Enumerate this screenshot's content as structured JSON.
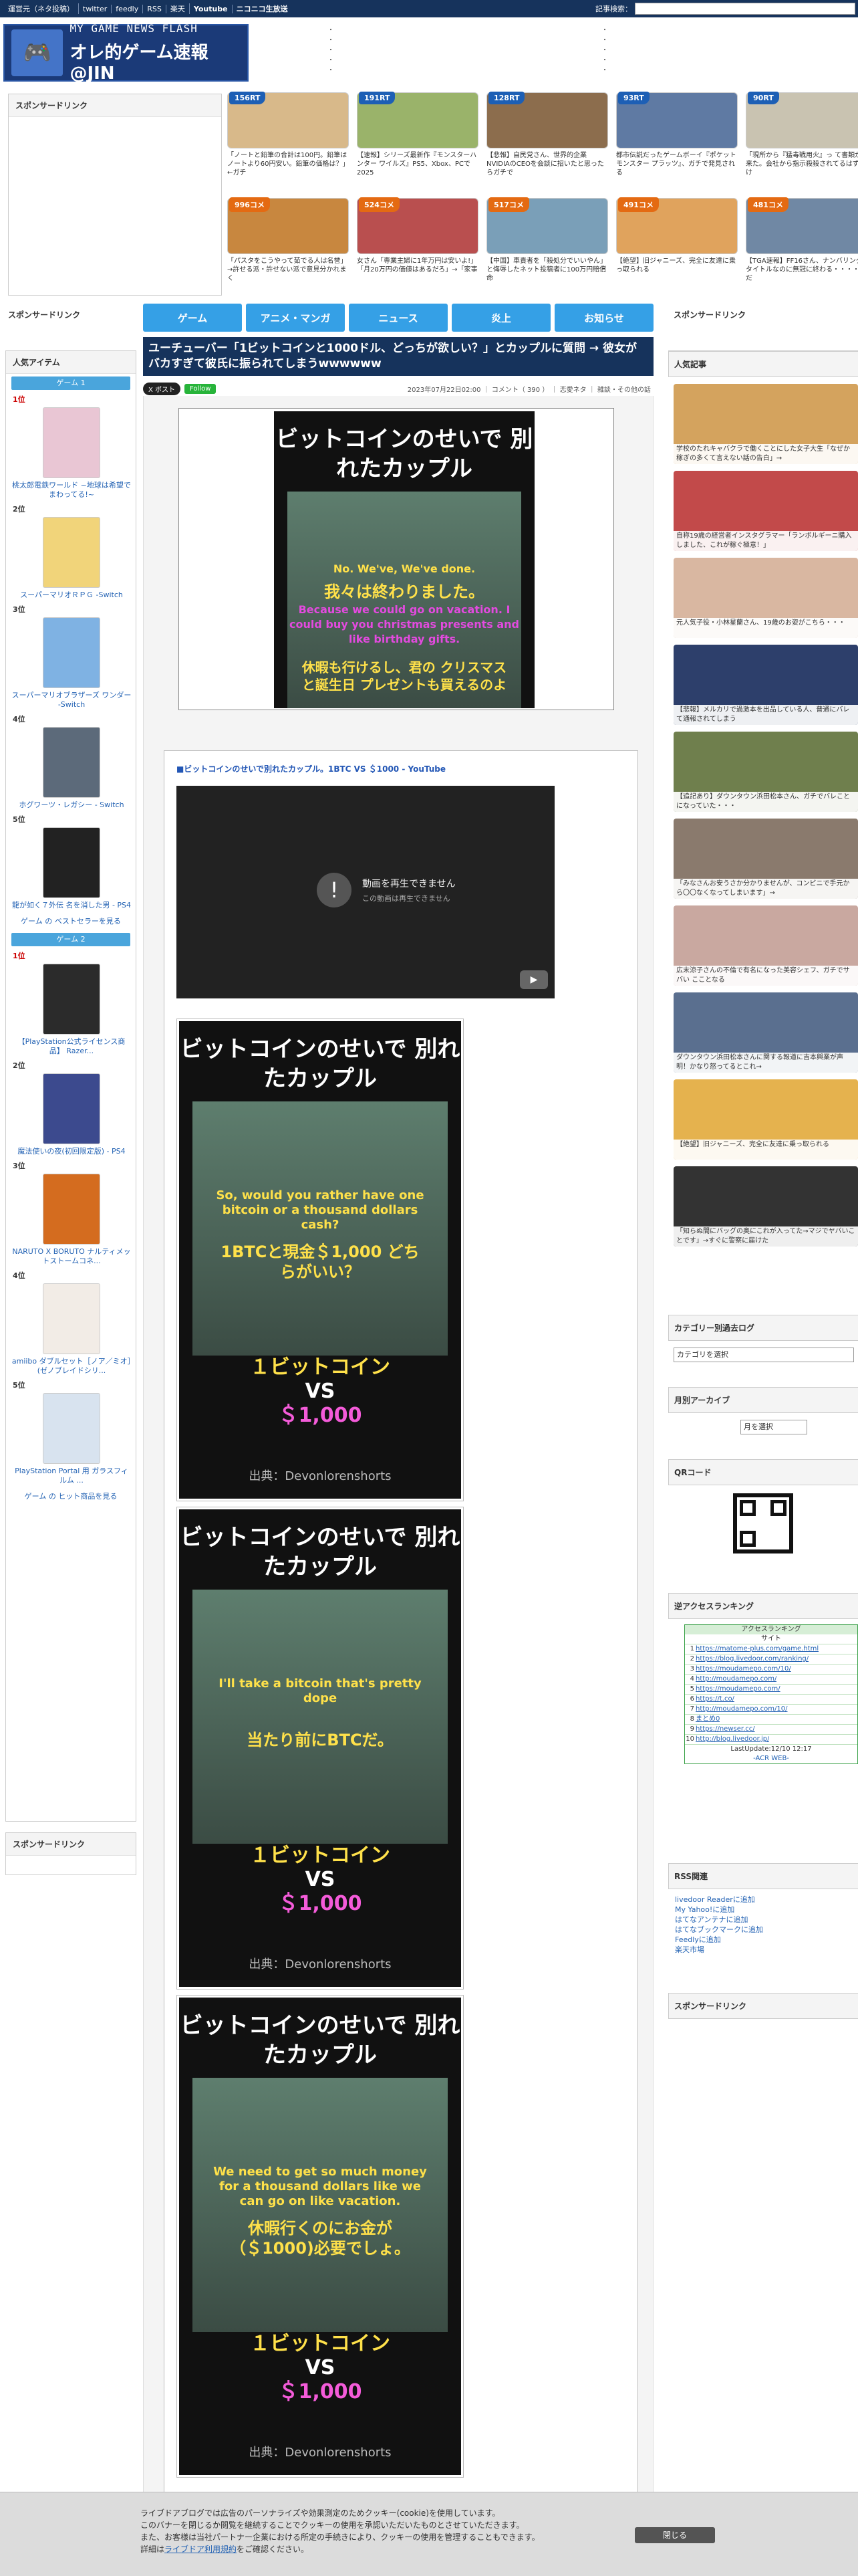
{
  "topbar": {
    "links": [
      "運営元（ネタ投稿）",
      "twitter",
      "feedly",
      "RSS",
      "楽天",
      "Youtube",
      "ニコニコ生放送"
    ],
    "search_label": "記事検索："
  },
  "site": {
    "logo_line1": "MY GAME NEWS FLASH",
    "logo_line2": "オレ的ゲーム速報@JIN"
  },
  "header_sponsor_title": "スポンサードリンク",
  "thumbs": [
    {
      "count": "156RT",
      "caption": "「ノートと鉛筆の合計は100円。鉛筆はノートより60円安い。鉛筆の価格は？」←ガチ"
    },
    {
      "count": "191RT",
      "caption": "【速報】シリーズ最新作『モンスターハンター ワイルズ』PS5、Xbox、PCで2025"
    },
    {
      "count": "128RT",
      "caption": "【悲報】自民党さん、世界的企業NVIDIAのCEOを会談に招いたと思ったらガチで"
    },
    {
      "count": "93RT",
      "caption": "都市伝説だったゲームボーイ『ポケットモンスター プラッツ』、ガチで発見される"
    },
    {
      "count": "90RT",
      "caption": "「現所から『猛毒戦用火』っ て書類が来た。会社から指示殺殺されてるはずだけ"
    },
    {
      "count": "996コメ",
      "caption": "「パスタをこうやって茹でる人は名誉」→許せる派・許せない派で意見分かれまく"
    },
    {
      "count": "524コメ",
      "caption": "女さん「専業主婦に1年万円は安いよ!」「月20万円の価値はあるだろ」→「家事"
    },
    {
      "count": "517コメ",
      "caption": "【中国】車責者を「殺処分でいいやん」と侮辱したネット投稿者に100万円賠償命"
    },
    {
      "count": "491コメ",
      "caption": "【絶望】旧ジャニーズ、完全に友達に乗っ取られる"
    },
    {
      "count": "481コメ",
      "caption": "【TGA速報】FF16さん、ナンバリングタイトルなのに無冠に終わる・・・・まだ"
    }
  ],
  "nav": [
    "ゲーム",
    "アニメ・マンガ",
    "ニュース",
    "炎上",
    "お知らせ"
  ],
  "left": {
    "sponsor_title": "スポンサードリンク",
    "items_title": "人気アイテム",
    "tab1": "ゲーム 1",
    "tab2": "ゲーム 2",
    "ranks1": [
      {
        "rank": "1位",
        "name": "桃太郎電鉄ワールド ~地球は希望でまわってる!~"
      },
      {
        "rank": "2位",
        "name": "スーパーマリオＲＰＧ -Switch"
      },
      {
        "rank": "3位",
        "name": "スーパーマリオブラザーズ ワンダー -Switch"
      },
      {
        "rank": "4位",
        "name": "ホグワーツ・レガシー - Switch"
      },
      {
        "rank": "5位",
        "name": "龍が如く７外伝 名を消した男 - PS4"
      }
    ],
    "bestseller1": "ゲーム の ベストセラーを見る",
    "ranks2": [
      {
        "rank": "1位",
        "name": "【PlayStation公式ライセンス商品】 Razer..."
      },
      {
        "rank": "2位",
        "name": "魔法使いの夜(初回限定版) - PS4"
      },
      {
        "rank": "3位",
        "name": "NARUTO X BORUTO ナルティメットストームコネ..."
      },
      {
        "rank": "4位",
        "name": "amiibo ダブルセット［ノア／ミオ］(ゼノブレイドシリ..."
      },
      {
        "rank": "5位",
        "name": "PlayStation Portal 用 ガラスフィルム ..."
      }
    ],
    "bestseller2": "ゲーム の ヒット商品を見る",
    "sponsor_title2": "スポンサードリンク"
  },
  "article": {
    "title": "ユーチューバー「1ビットコインと1000ドル、どっちが欲しい？」とカップルに質問 → 彼女がバカすぎて彼氏に振られてしまうwwwwww",
    "x_button": "X ポスト",
    "follow_button": "Follow",
    "meta": "2023年07月22日02:00 ｜ コメント（ 390 ） ｜ 恋愛ネタ ｜ 雑談・その他の話",
    "eyecatch_title": "ビットコインのせいで 別れたカップル",
    "eyecatch_en": "No. We've, We've done.",
    "eyecatch_ja": "我々は終わりました。",
    "eyecatch_en2": "Because we could go on vacation. I could buy you christmas presents and like birthday gifts.",
    "eyecatch_ja2": "休暇も行けるし、君の クリスマスと誕生日 プレゼントも買えるのよ",
    "yt_link": "■ビットコインのせいで別れたカップル。1BTC VS ＄1000 - YouTube",
    "yt_error": "動画を再生できません",
    "yt_error2": "この動画は再生できません",
    "frames": [
      {
        "en": "So, would you rather have one bitcoin or a thousand dollars cash?",
        "ja": "1BTCと現金＄1,000 どちらがいい？"
      },
      {
        "en": "I'll take a bitcoin that's pretty dope",
        "ja": "当たり前にBTCだ。"
      },
      {
        "en": "We need to get so much money for a thousand dollars like we can go on like vacation.",
        "ja": "休暇行くのにお金が （＄1000)必要でしょ。"
      }
    ],
    "vs_top": "１ビットコイン",
    "vs_mid": "VS",
    "vs_bottom": "＄1,000",
    "source": "出典：Devonlorenshorts"
  },
  "right": {
    "sponsor_title": "スポンサードリンク",
    "popular_title": "人気記事",
    "popular": [
      "学校のたれキャバクラで働くことにした女子大生「なぜか稼ぎの多くて言えない話の告白」→",
      "自称19歳の経営者インスタグラマー「ランボルギーニ購入しました、これが稼ぐ極意！」",
      "元人気子役・小林星蘭さん、19歳のお姿がこちら・・・",
      "【悲報】メルカリで過激本を出品している人、普通にバレて通報されてしまう",
      "【追記あり】ダウンタウン浜田松本さん、ガチでバレことになっていた・・・",
      "「みなさんお安うさか分かりませんが、コンビニで手元から〇〇なくなってしまいます」→",
      "広末涼子さんの不倫で有名になった美容シェフ、ガチでサバい こことなる",
      "ダウンタウン浜田松本さんに関する報道に吉本興業が声明！かなり怒ってるとこれ→",
      "【絶望】旧ジャニーズ、完全に友達に乗っ取られる",
      "「知らぬ間にバッグの奥にこれが入ってた→マジでヤバいことです」→すぐに警察に届けた"
    ],
    "category_title": "カテゴリー別過去ログ",
    "category_select": "カテゴリを選択",
    "archive_title": "月別アーカイブ",
    "archive_select": "月を選択",
    "qr_title": "QRコード",
    "access_title": "逆アクセスランキング",
    "access_header1": "アクセスランキング",
    "access_header2": "サイト",
    "access_rows": [
      {
        "no": "1",
        "site": "https://matome-plus.com/game.html"
      },
      {
        "no": "2",
        "site": "https://blog.livedoor.com/ranking/"
      },
      {
        "no": "3",
        "site": "https://moudamepo.com/10/"
      },
      {
        "no": "4",
        "site": "http://moudamepo.com/"
      },
      {
        "no": "5",
        "site": "https://moudamepo.com/"
      },
      {
        "no": "6",
        "site": "https://t.co/"
      },
      {
        "no": "7",
        "site": "http://moudamepo.com/10/"
      },
      {
        "no": "8",
        "site": "まとめ0"
      },
      {
        "no": "9",
        "site": "https://newser.cc/"
      },
      {
        "no": "10",
        "site": "http://blog.livedoor.jp/"
      }
    ],
    "access_footer": "LastUpdate:12/10 12:17",
    "access_credit": "-ACR WEB-",
    "rss_title": "RSS関連",
    "rss_links": [
      "livedoor Readerに追加",
      "My Yahoo!に追加",
      "はてなアンテナに追加",
      "はてなブックマークに追加",
      "Feedlyに追加",
      "楽天市場"
    ],
    "sponsor_title2": "スポンサードリンク"
  },
  "cookie": {
    "line1": "ライブドアブログでは広告のパーソナライズや効果測定のためクッキー(cookie)を使用しています。",
    "line2": "このバナーを閉じるか閲覧を継続することでクッキーの使用を承認いただいたものとさせていただきます。",
    "line3": "また、お客様は当社パートナー企業における所定の手続きにより、クッキーの使用を管理することもできます。",
    "line4": "詳細は",
    "link": "ライブドア利用規約",
    "line4b": "をご確認ください。",
    "close": "閉じる"
  }
}
